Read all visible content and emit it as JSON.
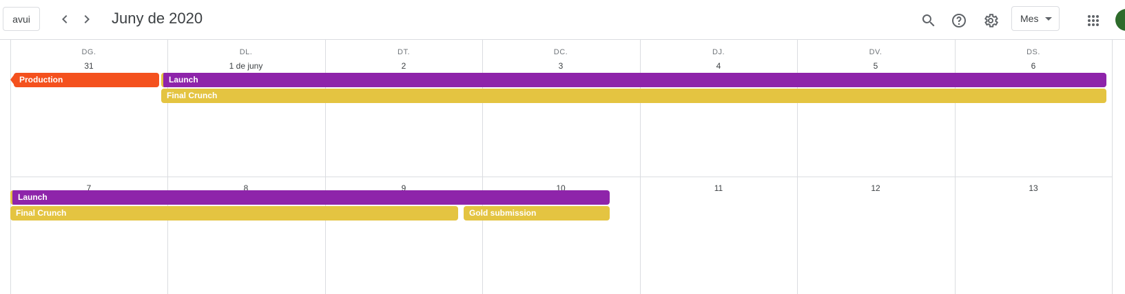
{
  "header": {
    "today_label": "avui",
    "title": "Juny de 2020",
    "view_label": "Mes"
  },
  "weekdays": [
    "DG.",
    "DL.",
    "DT.",
    "DC.",
    "DJ.",
    "DV.",
    "DS."
  ],
  "week1": {
    "days": [
      "31",
      "1 de juny",
      "2",
      "3",
      "4",
      "5",
      "6"
    ]
  },
  "week2": {
    "days": [
      "7",
      "8",
      "9",
      "10",
      "11",
      "12",
      "13"
    ]
  },
  "events": {
    "production": "Production",
    "launch_w1": "Launch",
    "crunch_w1": "Final Crunch",
    "launch_w2": "Launch",
    "crunch_w2": "Final Crunch",
    "gold": "Gold submission"
  },
  "colors": {
    "production": "#f4511e",
    "launch": "#8e24aa",
    "crunch": "#e4c441"
  },
  "icons": [
    "chevron-left-icon",
    "chevron-right-icon",
    "search-icon",
    "help-icon",
    "settings-icon",
    "dropdown-caret-icon",
    "apps-grid-icon"
  ]
}
